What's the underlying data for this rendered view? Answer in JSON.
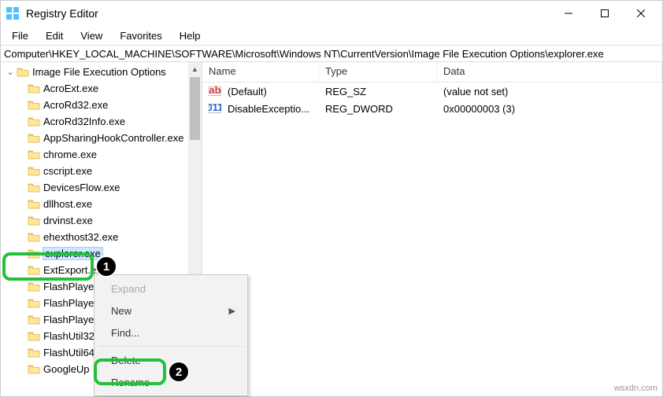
{
  "window": {
    "title": "Registry Editor"
  },
  "menubar": [
    "File",
    "Edit",
    "View",
    "Favorites",
    "Help"
  ],
  "address": "Computer\\HKEY_LOCAL_MACHINE\\SOFTWARE\\Microsoft\\Windows NT\\CurrentVersion\\Image File Execution Options\\explorer.exe",
  "tree": {
    "root": "Image File Execution Options",
    "items": [
      "AcroExt.exe",
      "AcroRd32.exe",
      "AcroRd32Info.exe",
      "AppSharingHookController.exe",
      "chrome.exe",
      "cscript.exe",
      "DevicesFlow.exe",
      "dllhost.exe",
      "drvinst.exe",
      "ehexthost32.exe",
      "explorer.exe",
      "ExtExport.exe",
      "FlashPlayer",
      "FlashPlayer",
      "FlashPlayer",
      "FlashUtil32",
      "FlashUtil64",
      "GoogleUp"
    ],
    "selected_index": 10
  },
  "list": {
    "columns": [
      "Name",
      "Type",
      "Data"
    ],
    "rows": [
      {
        "icon": "ab",
        "name": "(Default)",
        "type": "REG_SZ",
        "data": "(value not set)"
      },
      {
        "icon": "011",
        "name": "DisableExceptio...",
        "type": "REG_DWORD",
        "data": "0x00000003 (3)"
      }
    ]
  },
  "contextmenu": {
    "items": [
      {
        "label": "Expand",
        "disabled": true
      },
      {
        "label": "New",
        "submenu": true
      },
      {
        "label": "Find...",
        "disabled": false
      },
      {
        "sep": true
      },
      {
        "label": "Delete"
      },
      {
        "label": "Rename"
      }
    ]
  },
  "annotations": {
    "one": "1",
    "two": "2"
  },
  "watermark": "wsxdn.com"
}
